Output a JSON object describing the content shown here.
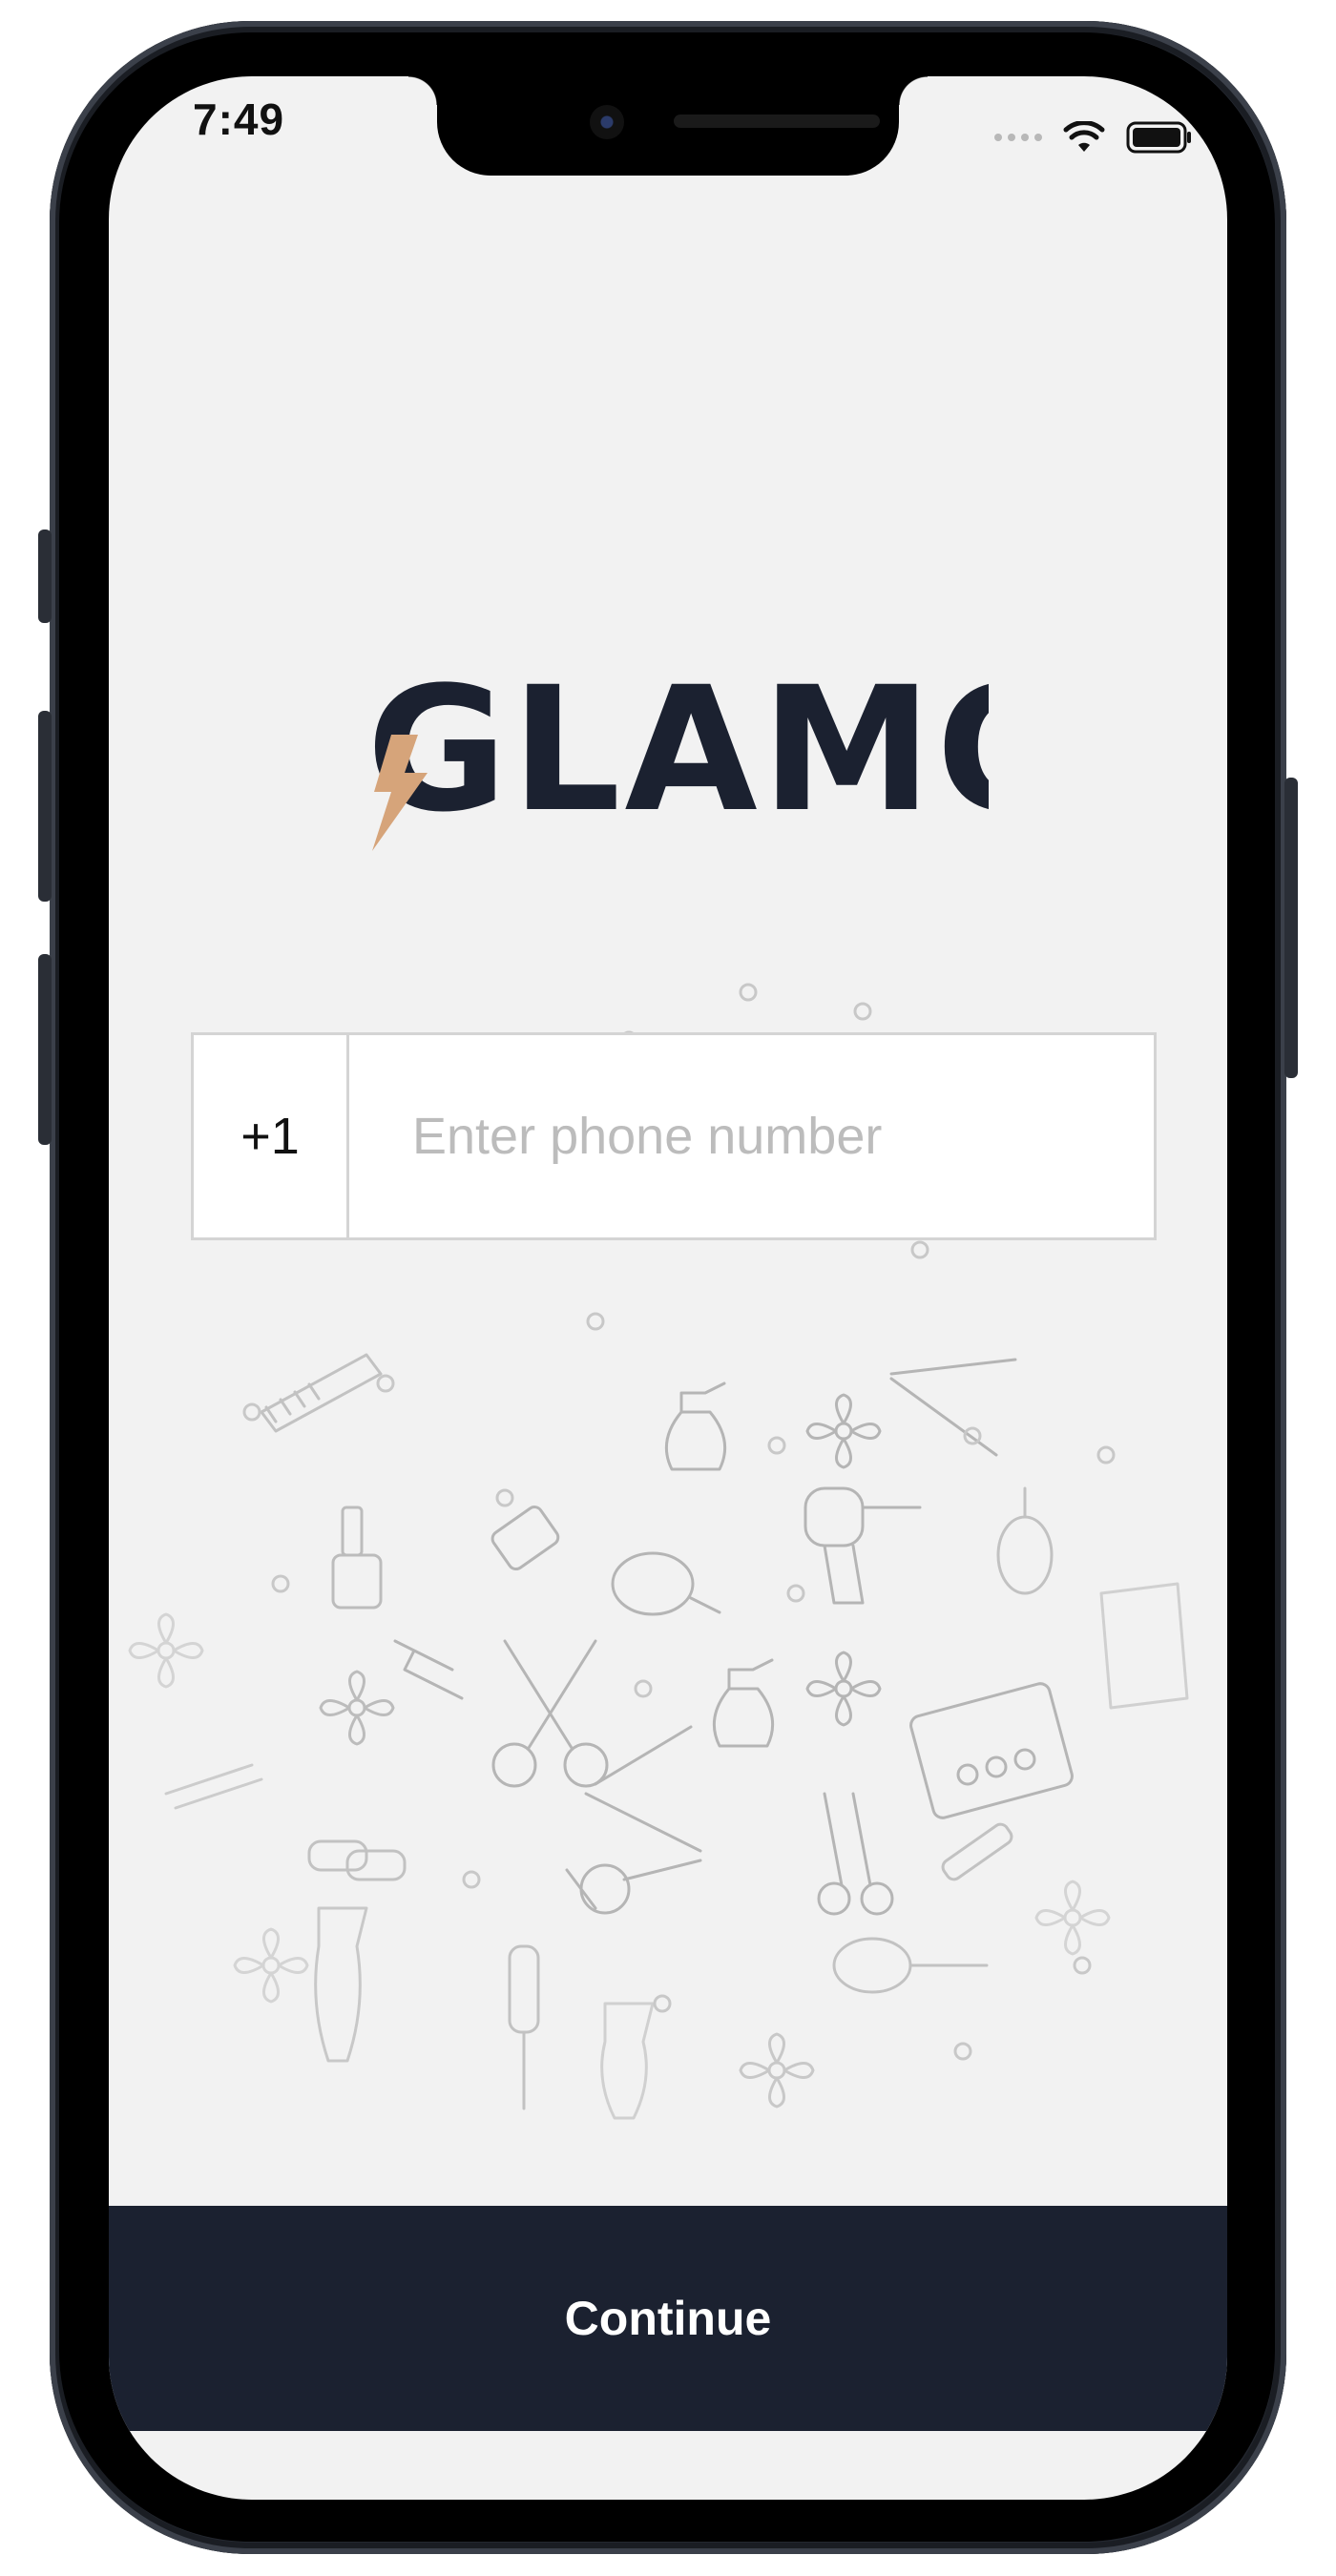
{
  "status_bar": {
    "time": "7:49",
    "icons": [
      "cellular-dots-icon",
      "wifi-icon",
      "battery-icon"
    ]
  },
  "brand": {
    "logo_text": "GLAMO",
    "logo_accent_color": "#d6a47a",
    "text_color": "#1b2130"
  },
  "phone_form": {
    "country_code": "+1",
    "placeholder": "Enter phone number",
    "value": ""
  },
  "actions": {
    "continue_label": "Continue"
  },
  "background_icons": [
    "scissors-icon",
    "spray-bottle-icon",
    "flower-icon",
    "nail-polish-icon",
    "hair-dryer-icon",
    "comb-icon",
    "hand-mirror-icon",
    "makeup-palette-icon",
    "brush-icon",
    "lipstick-icon",
    "hair-straightener-icon"
  ],
  "colors": {
    "screen_background": "#f2f2f2",
    "primary": "#1b2130",
    "input_border": "#d4d4d4",
    "placeholder": "#bcbcbc"
  }
}
